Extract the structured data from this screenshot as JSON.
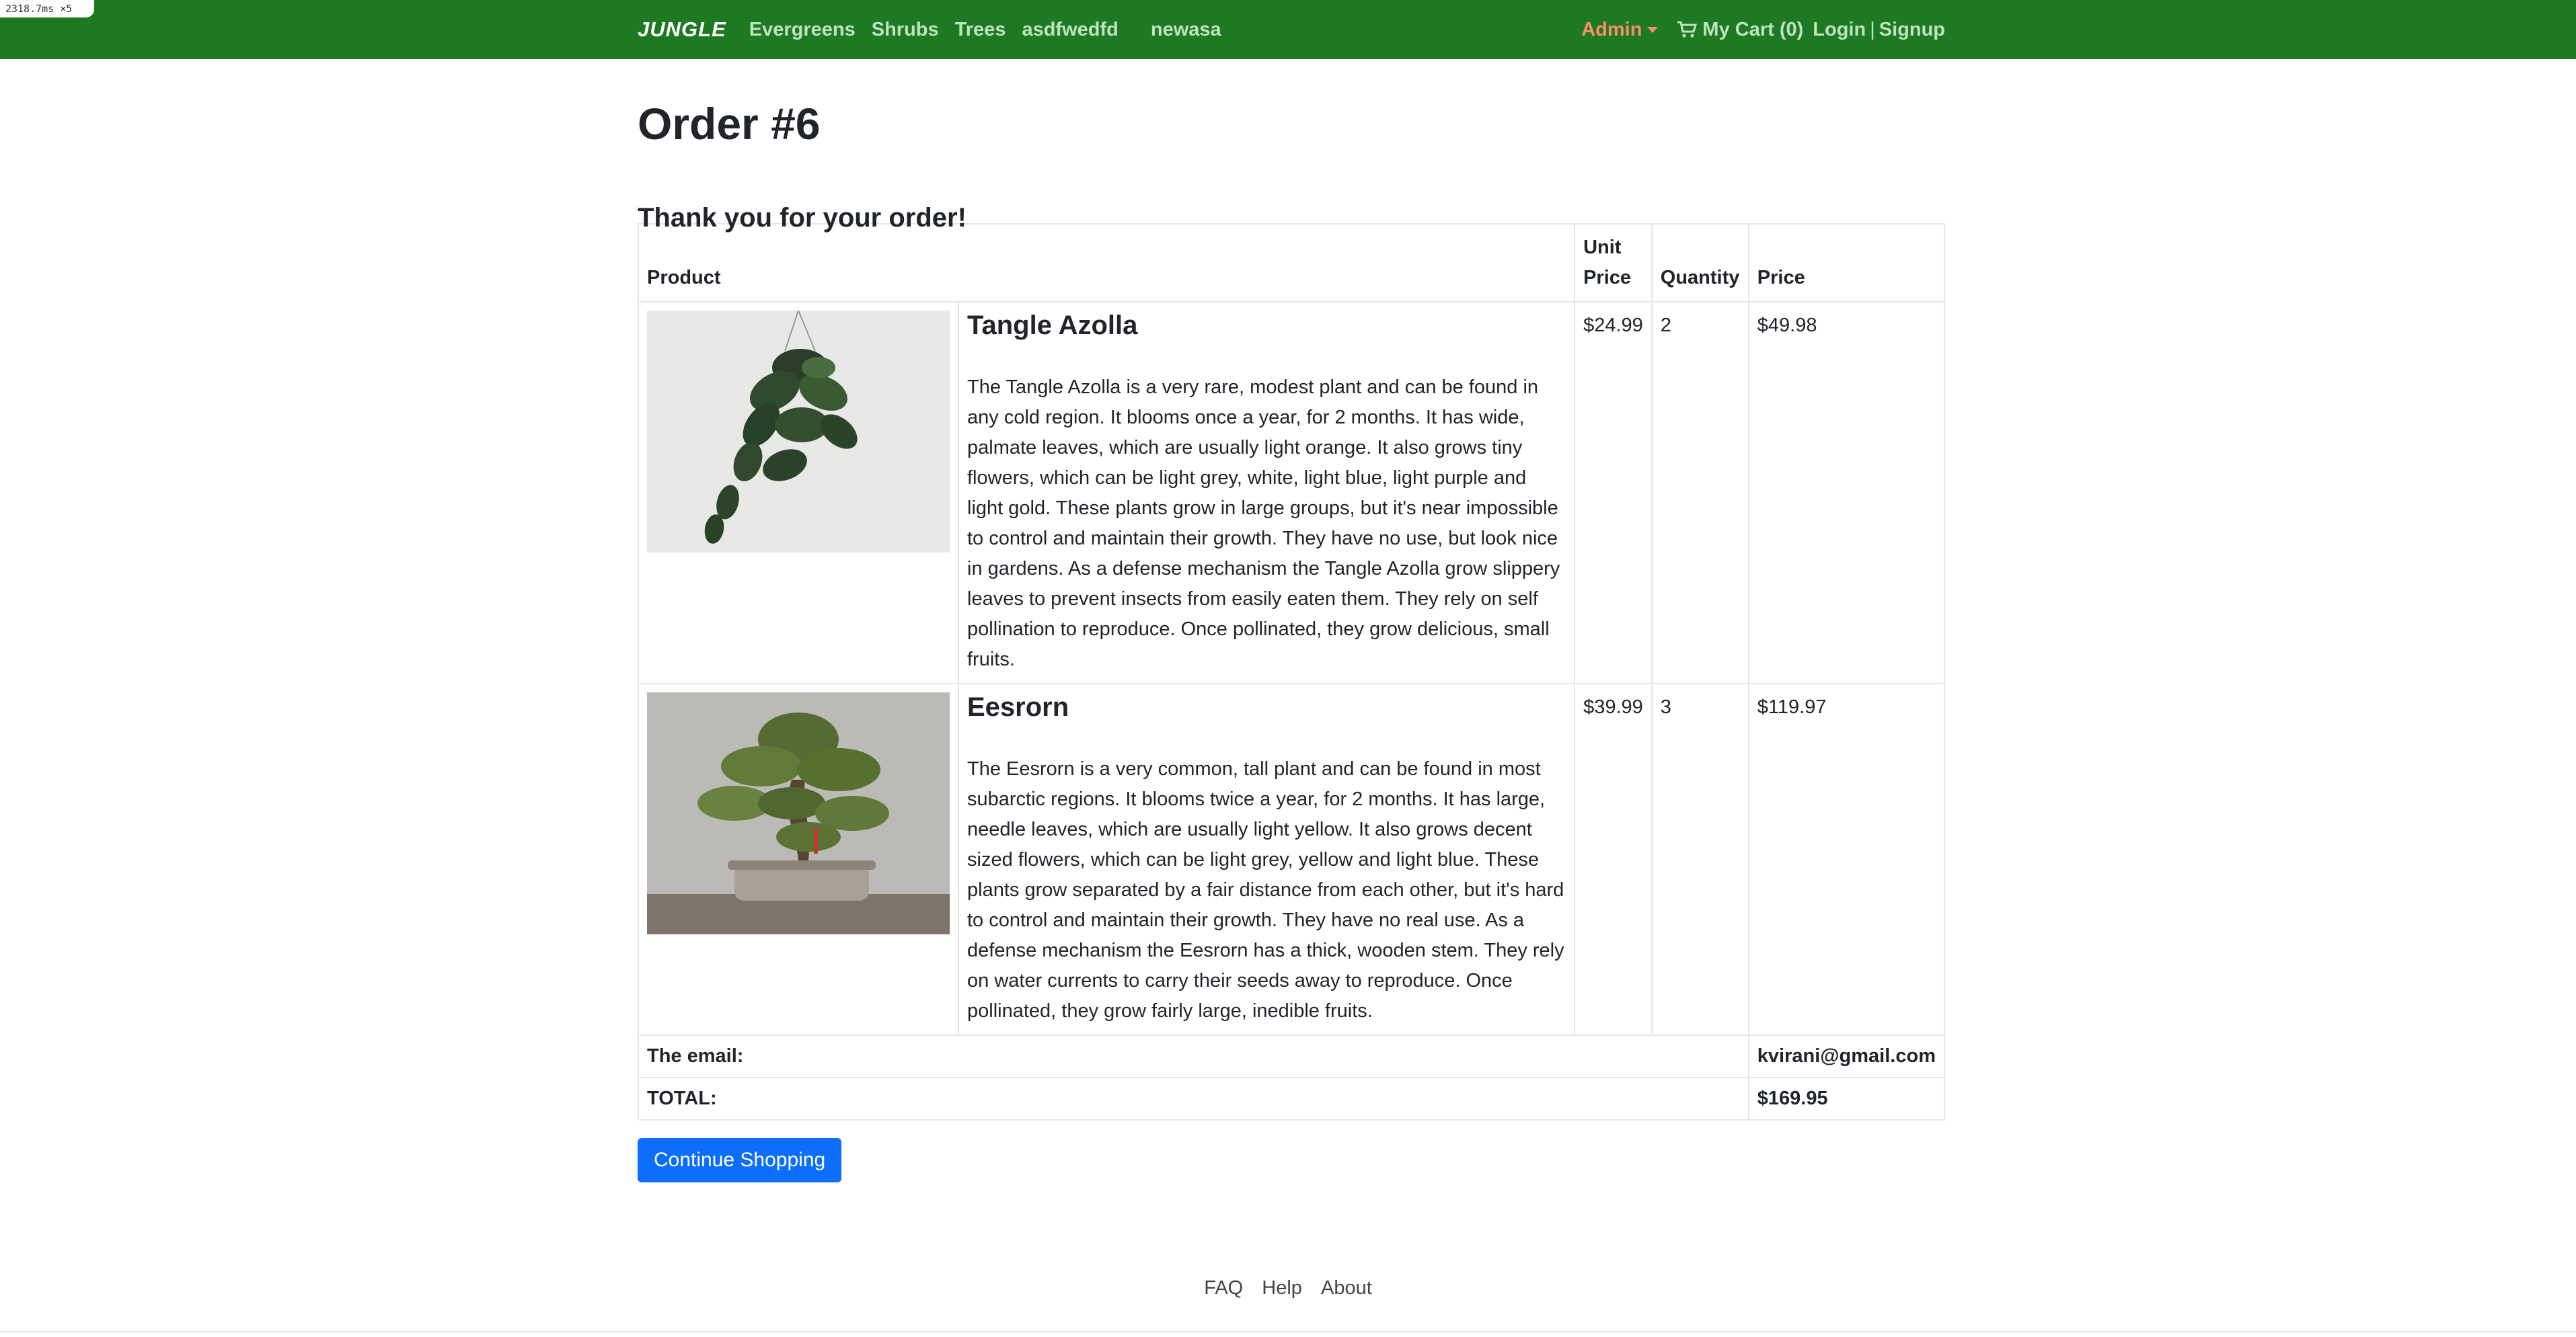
{
  "debug": {
    "text": "2318.7ms ×5"
  },
  "nav": {
    "brand": "JUNGLE",
    "links": [
      "Evergreens",
      "Shrubs",
      "Trees",
      "asdfwedfd",
      "newasa"
    ],
    "admin": "Admin",
    "cart": "My Cart (0)",
    "login": "Login",
    "separator": "|",
    "signup": "Signup"
  },
  "page": {
    "title": "Order #6",
    "subtitle": "Thank you for your order!"
  },
  "table": {
    "headers": {
      "product": "Product",
      "unit_price": "Unit Price",
      "quantity": "Quantity",
      "price": "Price"
    },
    "items": [
      {
        "name": "Tangle Azolla",
        "description": "The Tangle Azolla is a very rare, modest plant and can be found in any cold region. It blooms once a year, for 2 months. It has wide, palmate leaves, which are usually light orange. It also grows tiny flowers, which can be light grey, white, light blue, light purple and light gold. These plants grow in large groups, but it's near impossible to control and maintain their growth. They have no use, but look nice in gardens. As a defense mechanism the Tangle Azolla grow slippery leaves to prevent insects from easily eaten them. They rely on self pollination to reproduce. Once pollinated, they grow delicious, small fruits.",
        "unit_price": "$24.99",
        "quantity": "2",
        "price": "$49.98",
        "image": "hanging-pothos-plant-image"
      },
      {
        "name": "Eesrorn",
        "description": "The Eesrorn is a very common, tall plant and can be found in most subarctic regions. It blooms twice a year, for 2 months. It has large, needle leaves, which are usually light yellow. It also grows decent sized flowers, which can be light grey, yellow and light blue. These plants grow separated by a fair distance from each other, but it's hard to control and maintain their growth. They have no real use. As a defense mechanism the Eesrorn has a thick, wooden stem. They rely on water currents to carry their seeds away to reproduce. Once pollinated, they grow fairly large, inedible fruits.",
        "unit_price": "$39.99",
        "quantity": "3",
        "price": "$119.97",
        "image": "bonsai-tree-image"
      }
    ],
    "email_label": "The email:",
    "email_value": "kvirani@gmail.com",
    "total_label": "TOTAL:",
    "total_value": "$169.95"
  },
  "button": {
    "continue": "Continue Shopping"
  },
  "footer": {
    "links": [
      "FAQ",
      "Help",
      "About"
    ]
  },
  "colors": {
    "navbar": "#1d7a22",
    "admin": "#ff8c6b",
    "button": "#0d6efd"
  }
}
